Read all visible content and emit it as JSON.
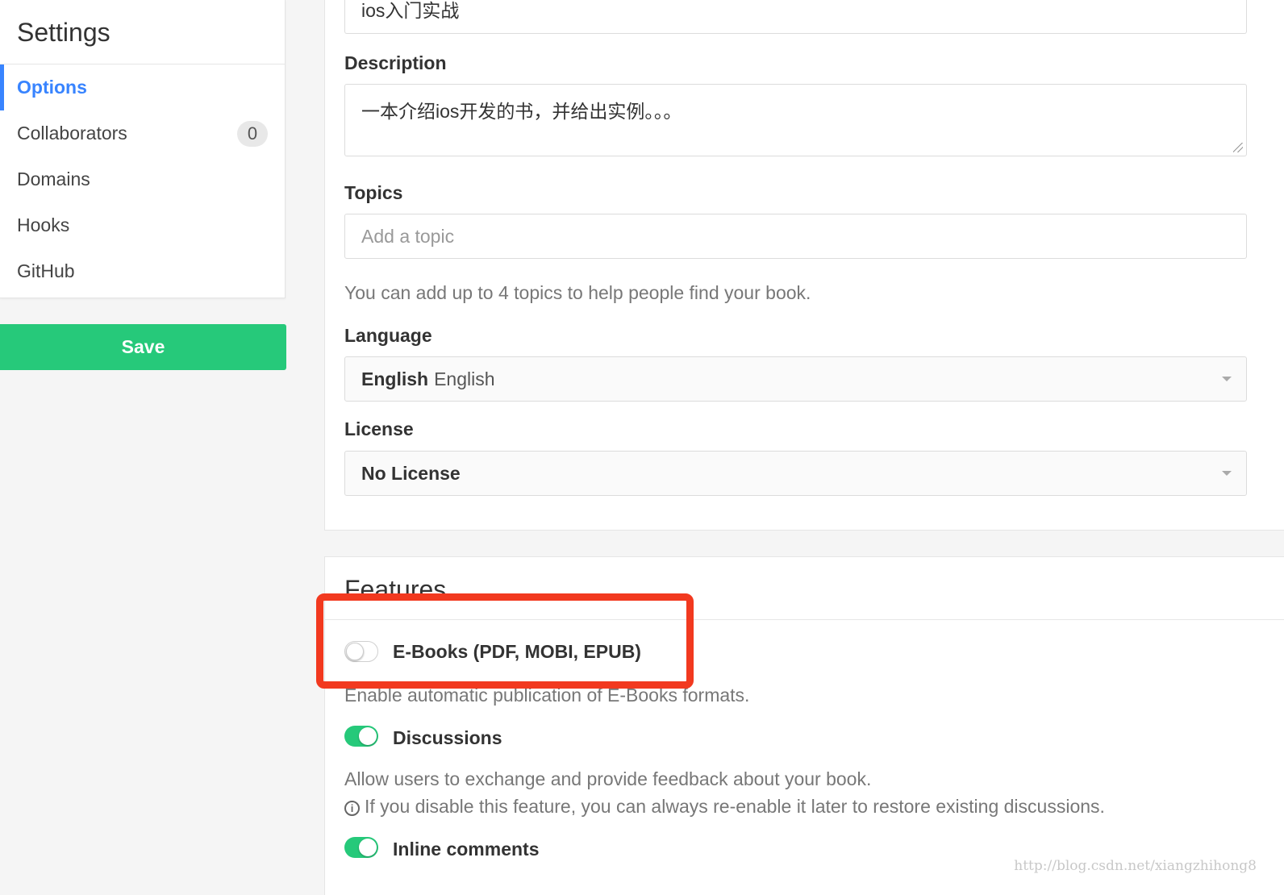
{
  "sidebar": {
    "title": "Settings",
    "items": [
      {
        "label": "Options",
        "active": true
      },
      {
        "label": "Collaborators",
        "badge": "0"
      },
      {
        "label": "Domains"
      },
      {
        "label": "Hooks"
      },
      {
        "label": "GitHub"
      }
    ],
    "save_label": "Save"
  },
  "form": {
    "title_value": "ios入门实战",
    "description": {
      "label": "Description",
      "value": "一本介绍ios开发的书，并给出实例。。。"
    },
    "topics": {
      "label": "Topics",
      "placeholder": "Add a topic",
      "help": "You can add up to 4 topics to help people find your book."
    },
    "language": {
      "label": "Language",
      "value": "English",
      "value_native": "English"
    },
    "license": {
      "label": "License",
      "value": "No License"
    }
  },
  "features": {
    "title": "Features",
    "ebooks": {
      "label": "E-Books (PDF, MOBI, EPUB)",
      "enabled": false,
      "help": "Enable automatic publication of E-Books formats."
    },
    "discussions": {
      "label": "Discussions",
      "enabled": true,
      "help": "Allow users to exchange and provide feedback about your book.",
      "note": "If you disable this feature, you can always re-enable it later to restore existing discussions."
    },
    "inline_comments": {
      "label": "Inline comments",
      "enabled": true
    }
  },
  "colors": {
    "accent_blue": "#3884ff",
    "save_green": "#26c97a",
    "highlight_red": "#f2391f"
  },
  "watermark": "http://blog.csdn.net/xiangzhihong8"
}
